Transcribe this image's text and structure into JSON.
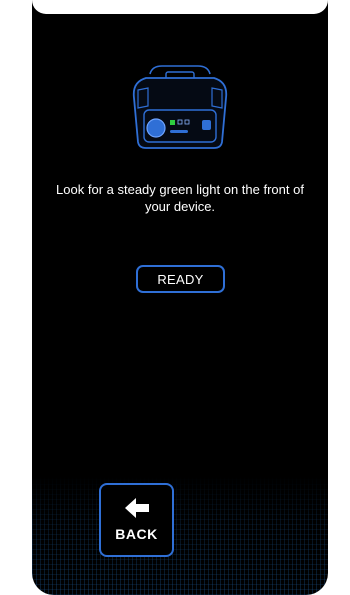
{
  "instruction": {
    "text": "Look for a steady green light on the front of your device."
  },
  "ready_button": {
    "label": "READY"
  },
  "back_button": {
    "label": "BACK",
    "icon": "arrow-left-icon"
  },
  "device_illustration": {
    "icon": "radar-detector-device-icon",
    "indicator_color": "#2ecc40",
    "accent_color": "#2f6fd6"
  },
  "colors": {
    "background": "#000000",
    "accent": "#2f6fd6",
    "text": "#ffffff"
  }
}
